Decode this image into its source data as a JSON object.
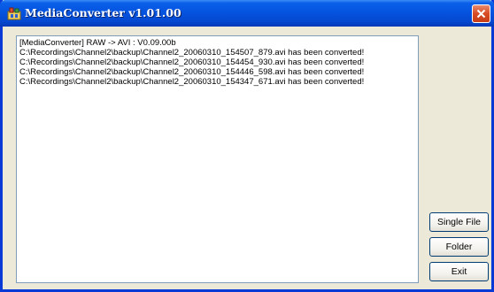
{
  "window": {
    "title": "MediaConverter v1.01.00",
    "icon": "app-icon",
    "close_icon": "close-icon"
  },
  "log": {
    "lines": [
      "[MediaConverter] RAW -> AVI : V0.09.00b",
      "C:\\Recordings\\Channel2\\backup\\Channel2_20060310_154507_879.avi has been converted!",
      "C:\\Recordings\\Channel2\\backup\\Channel2_20060310_154454_930.avi has been converted!",
      "C:\\Recordings\\Channel2\\backup\\Channel2_20060310_154446_598.avi has been converted!",
      "C:\\Recordings\\Channel2\\backup\\Channel2_20060310_154347_671.avi has been converted!"
    ]
  },
  "buttons": {
    "single_file": "Single File",
    "folder": "Folder",
    "exit": "Exit"
  },
  "colors": {
    "titlebar": "#0554e0",
    "window_bg": "#ece9d8",
    "close": "#d84b23"
  }
}
